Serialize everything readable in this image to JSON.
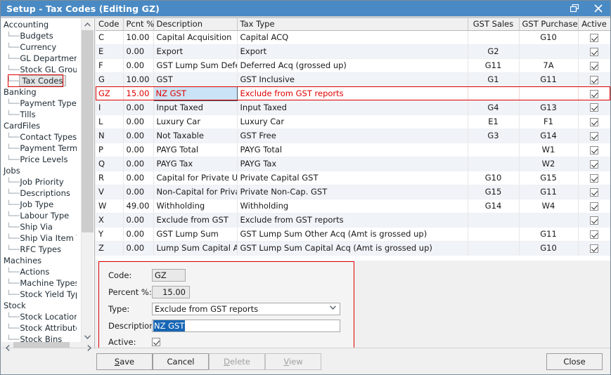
{
  "window": {
    "title": "Setup - Tax Codes (Editing GZ)",
    "restore_icon": "restore-icon",
    "close_icon": "close-icon",
    "accent_color": "#4a8ac4",
    "highlight_color": "#e00000"
  },
  "sidebar": {
    "items": [
      {
        "label": "Accounting",
        "level": 0,
        "selected": false
      },
      {
        "label": "Budgets",
        "level": 1,
        "selected": false
      },
      {
        "label": "Currency",
        "level": 1,
        "selected": false
      },
      {
        "label": "GL Departments",
        "level": 1,
        "selected": false
      },
      {
        "label": "Stock GL Groups",
        "level": 1,
        "selected": false
      },
      {
        "label": "Tax Codes",
        "level": 1,
        "selected": true
      },
      {
        "label": "Banking",
        "level": 0,
        "selected": false
      },
      {
        "label": "Payment Type",
        "level": 1,
        "selected": false
      },
      {
        "label": "Tills",
        "level": 1,
        "selected": false
      },
      {
        "label": "CardFiles",
        "level": 0,
        "selected": false
      },
      {
        "label": "Contact Types",
        "level": 1,
        "selected": false
      },
      {
        "label": "Payment Terms",
        "level": 1,
        "selected": false
      },
      {
        "label": "Price Levels",
        "level": 1,
        "selected": false
      },
      {
        "label": "Jobs",
        "level": 0,
        "selected": false
      },
      {
        "label": "Job Priority",
        "level": 1,
        "selected": false
      },
      {
        "label": "Descriptions",
        "level": 1,
        "selected": false
      },
      {
        "label": "Job Type",
        "level": 1,
        "selected": false
      },
      {
        "label": "Labour Type",
        "level": 1,
        "selected": false
      },
      {
        "label": "Ship Via",
        "level": 1,
        "selected": false
      },
      {
        "label": "Ship Via Item Types",
        "level": 1,
        "selected": false
      },
      {
        "label": "RFC Types",
        "level": 1,
        "selected": false
      },
      {
        "label": "Machines",
        "level": 0,
        "selected": false
      },
      {
        "label": "Actions",
        "level": 1,
        "selected": false
      },
      {
        "label": "Machine Types",
        "level": 1,
        "selected": false
      },
      {
        "label": "Stock Yield Types",
        "level": 1,
        "selected": false
      },
      {
        "label": "Stock",
        "level": 0,
        "selected": false
      },
      {
        "label": "Stock Locations",
        "level": 1,
        "selected": false
      },
      {
        "label": "Stock Attributes",
        "level": 1,
        "selected": false
      },
      {
        "label": "Stock Bins",
        "level": 1,
        "selected": false
      }
    ],
    "scroll_up_icon": "chevron-up-icon",
    "scroll_down_icon": "chevron-down-icon",
    "scroll_left_icon": "chevron-left-icon",
    "scroll_right_icon": "chevron-right-icon"
  },
  "grid": {
    "columns": [
      "Code",
      "Pcnt %",
      "Description",
      "Tax Type",
      "GST Sales",
      "GST Purchase",
      "Active"
    ],
    "rows": [
      {
        "code": "C",
        "pcnt": "10.00",
        "description": "Capital Acquisition",
        "tax_type": "Capital ACQ",
        "gst_sales": "",
        "gst_purchase": "G10",
        "active": true,
        "selected": false
      },
      {
        "code": "E",
        "pcnt": "0.00",
        "description": "Export",
        "tax_type": "Export",
        "gst_sales": "G2",
        "gst_purchase": "",
        "active": true,
        "selected": false
      },
      {
        "code": "F",
        "pcnt": "0.00",
        "description": "GST Lump Sum Deferre",
        "tax_type": "Deferred Acq (grossed up)",
        "gst_sales": "G11",
        "gst_purchase": "7A",
        "active": true,
        "selected": false
      },
      {
        "code": "G",
        "pcnt": "10.00",
        "description": "GST",
        "tax_type": "GST Inclusive",
        "gst_sales": "G1",
        "gst_purchase": "G11",
        "active": true,
        "selected": false
      },
      {
        "code": "GZ",
        "pcnt": "15.00",
        "description": "NZ GST",
        "tax_type": "Exclude from GST reports",
        "gst_sales": "",
        "gst_purchase": "",
        "active": true,
        "selected": true
      },
      {
        "code": "I",
        "pcnt": "0.00",
        "description": "Input Taxed",
        "tax_type": "Input Taxed",
        "gst_sales": "G4",
        "gst_purchase": "G13",
        "active": true,
        "selected": false
      },
      {
        "code": "L",
        "pcnt": "0.00",
        "description": "Luxury Car",
        "tax_type": "Luxury Car",
        "gst_sales": "E1",
        "gst_purchase": "F1",
        "active": true,
        "selected": false
      },
      {
        "code": "N",
        "pcnt": "0.00",
        "description": "Not Taxable",
        "tax_type": "GST Free",
        "gst_sales": "G3",
        "gst_purchase": "G14",
        "active": true,
        "selected": false
      },
      {
        "code": "P",
        "pcnt": "0.00",
        "description": "PAYG Total",
        "tax_type": "PAYG Total",
        "gst_sales": "",
        "gst_purchase": "W1",
        "active": true,
        "selected": false
      },
      {
        "code": "Q",
        "pcnt": "0.00",
        "description": "PAYG Tax",
        "tax_type": "PAYG Tax",
        "gst_sales": "",
        "gst_purchase": "W2",
        "active": true,
        "selected": false
      },
      {
        "code": "R",
        "pcnt": "0.00",
        "description": "Capital for Private Use",
        "tax_type": "Private Capital GST",
        "gst_sales": "G10",
        "gst_purchase": "G15",
        "active": true,
        "selected": false
      },
      {
        "code": "V",
        "pcnt": "0.00",
        "description": "Non-Capital for Private",
        "tax_type": "Private Non-Cap. GST",
        "gst_sales": "G15",
        "gst_purchase": "G11",
        "active": true,
        "selected": false
      },
      {
        "code": "W",
        "pcnt": "49.00",
        "description": "Withholding",
        "tax_type": "Withholding",
        "gst_sales": "G14",
        "gst_purchase": "W4",
        "active": true,
        "selected": false
      },
      {
        "code": "X",
        "pcnt": "0.00",
        "description": "Exclude from GST",
        "tax_type": "Exclude from GST reports",
        "gst_sales": "",
        "gst_purchase": "",
        "active": true,
        "selected": false
      },
      {
        "code": "Y",
        "pcnt": "0.00",
        "description": "GST Lump Sum",
        "tax_type": "GST Lump Sum Other Acq (Amt is grossed up)",
        "gst_sales": "",
        "gst_purchase": "G11",
        "active": true,
        "selected": false
      },
      {
        "code": "Z",
        "pcnt": "0.00",
        "description": "Lump Sum Capital Acq",
        "tax_type": "GST Lump Sum Capital Acq (Amt is grossed up)",
        "gst_sales": "",
        "gst_purchase": "G10",
        "active": true,
        "selected": false
      }
    ]
  },
  "edit_form": {
    "code_label": "Code:",
    "code_value": "GZ",
    "percent_label": "Percent %:",
    "percent_value": "15.00",
    "type_label": "Type:",
    "type_value": "Exclude from GST reports",
    "description_label": "Description:",
    "description_value": "NZ GST",
    "active_label": "Active:",
    "active_checked": true,
    "dropdown_icon": "chevron-down-icon"
  },
  "footer": {
    "save": "Save",
    "save_accel": "S",
    "cancel": "Cancel",
    "delete": "Delete",
    "delete_accel": "D",
    "view": "View",
    "view_accel": "V",
    "close": "Close"
  }
}
